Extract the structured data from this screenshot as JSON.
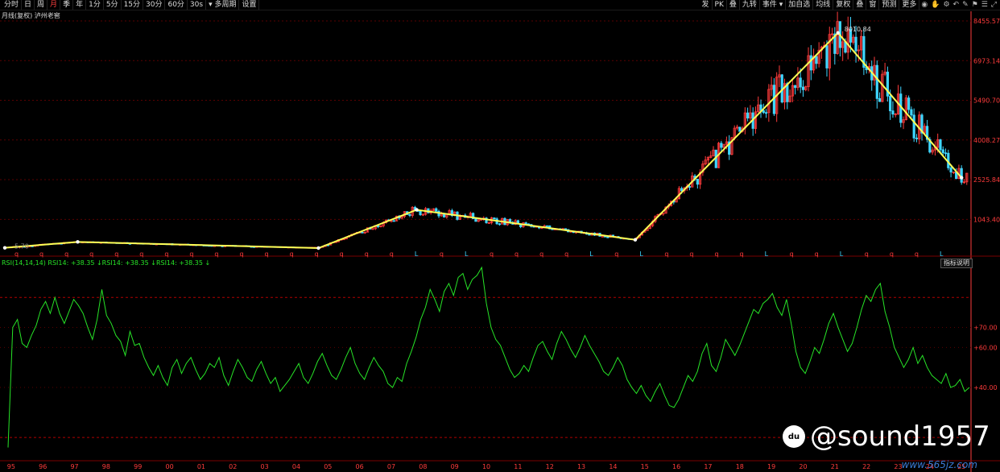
{
  "toolbar": {
    "left": [
      "分时",
      "日",
      "周",
      "月",
      "季",
      "年",
      "1分",
      "5分",
      "15分",
      "30分",
      "60分",
      "30s",
      "▾ 多周期",
      "设置"
    ],
    "active": "月",
    "right": [
      "发",
      "PK",
      "叠",
      "九转",
      "事件 ▾",
      "加自选",
      "均线",
      "复权",
      "叠",
      "窗",
      "预测",
      "更多"
    ],
    "right_icons": [
      "eye-icon",
      "hand-icon",
      "gear-icon",
      "undo-icon",
      "pencil-icon",
      "flag-icon",
      "list-icon",
      "fullscreen-icon"
    ]
  },
  "title": "月线(复权) 泸州老窖",
  "rsi_legend": "RSI(14,14,14) RSI14: +38.35 ↓RSI14: +38.35 ↓RSI14: +38.35 ↓",
  "rsi_help": "指标说明",
  "watermark": "@sound1957",
  "watermark_icon": "du",
  "site": "www.565jz.com",
  "colors": {
    "up": "#ff3b3b",
    "down": "#3fd6ff",
    "trend": "#ffff55",
    "rsi": "#27e427",
    "axis": "#ff3b3b",
    "grid": "#5a0000"
  },
  "chart_data": [
    {
      "type": "candlestick",
      "title": "月线(复权) 泸州老窖",
      "price_axis_ticks": [
        8455.57,
        6973.14,
        5490.7,
        4008.27,
        2525.84,
        1043.4
      ],
      "ylim": [
        -30,
        8455.57
      ],
      "x_start_year": 1994.8,
      "x_end_year": 2025.3,
      "trendline": [
        {
          "year": 1994.8,
          "price": -20
        },
        {
          "year": 1997.1,
          "price": 200
        },
        {
          "year": 2004.7,
          "price": -30
        },
        {
          "year": 2007.8,
          "price": 1400
        },
        {
          "year": 2014.7,
          "price": 280
        },
        {
          "year": 2021.1,
          "price": 8010.84
        },
        {
          "year": 2025.0,
          "price": 2600
        }
      ],
      "peak_label": "8010.84",
      "low_label": "5.70",
      "markers": "q q q q q q q q q q q q q q q q L q L q q q q L q L q q q q L q q L q q q L"
    },
    {
      "type": "line",
      "name": "RSI14",
      "yticks": [
        70.0,
        60.0,
        40.0
      ],
      "ytick_labels": [
        "+70.00",
        "+60.00",
        "+40.00"
      ],
      "ylim": [
        5,
        100
      ],
      "x_labels": [
        "95",
        "96",
        "97",
        "98",
        "99",
        "00",
        "01",
        "02",
        "03",
        "04",
        "05",
        "06",
        "07",
        "08",
        "09",
        "10",
        "11",
        "12",
        "13",
        "14",
        "15",
        "16",
        "17",
        "18",
        "19",
        "20",
        "21",
        "22",
        "23",
        "24",
        "25"
      ],
      "values": [
        10,
        70,
        74,
        62,
        60,
        66,
        71,
        79,
        83,
        77,
        85,
        77,
        72,
        78,
        84,
        81,
        77,
        70,
        64,
        74,
        89,
        76,
        72,
        66,
        63,
        56,
        68,
        61,
        62,
        55,
        50,
        46,
        51,
        45,
        41,
        50,
        54,
        47,
        52,
        55,
        49,
        44,
        47,
        52,
        50,
        55,
        46,
        41,
        48,
        54,
        50,
        45,
        43,
        49,
        53,
        47,
        42,
        45,
        38,
        41,
        44,
        48,
        52,
        45,
        42,
        47,
        53,
        57,
        51,
        46,
        44,
        49,
        55,
        60,
        52,
        47,
        44,
        50,
        55,
        51,
        48,
        42,
        40,
        45,
        43,
        52,
        58,
        65,
        74,
        80,
        89,
        84,
        78,
        88,
        92,
        86,
        95,
        97,
        89,
        94,
        96,
        100,
        82,
        70,
        64,
        61,
        55,
        49,
        45,
        47,
        51,
        48,
        55,
        61,
        63,
        58,
        54,
        62,
        68,
        64,
        59,
        55,
        60,
        66,
        61,
        57,
        53,
        48,
        46,
        50,
        55,
        51,
        44,
        40,
        37,
        41,
        36,
        33,
        38,
        42,
        36,
        31,
        30,
        34,
        40,
        46,
        43,
        48,
        57,
        62,
        51,
        48,
        55,
        64,
        60,
        56,
        61,
        67,
        73,
        79,
        77,
        82,
        84,
        87,
        80,
        76,
        84,
        72,
        58,
        50,
        47,
        53,
        60,
        57,
        64,
        72,
        77,
        70,
        64,
        58,
        62,
        70,
        79,
        86,
        83,
        89,
        92,
        78,
        70,
        60,
        55,
        50,
        54,
        60,
        52,
        56,
        50,
        46,
        44,
        42,
        47,
        40,
        41,
        44,
        38,
        40
      ]
    }
  ]
}
